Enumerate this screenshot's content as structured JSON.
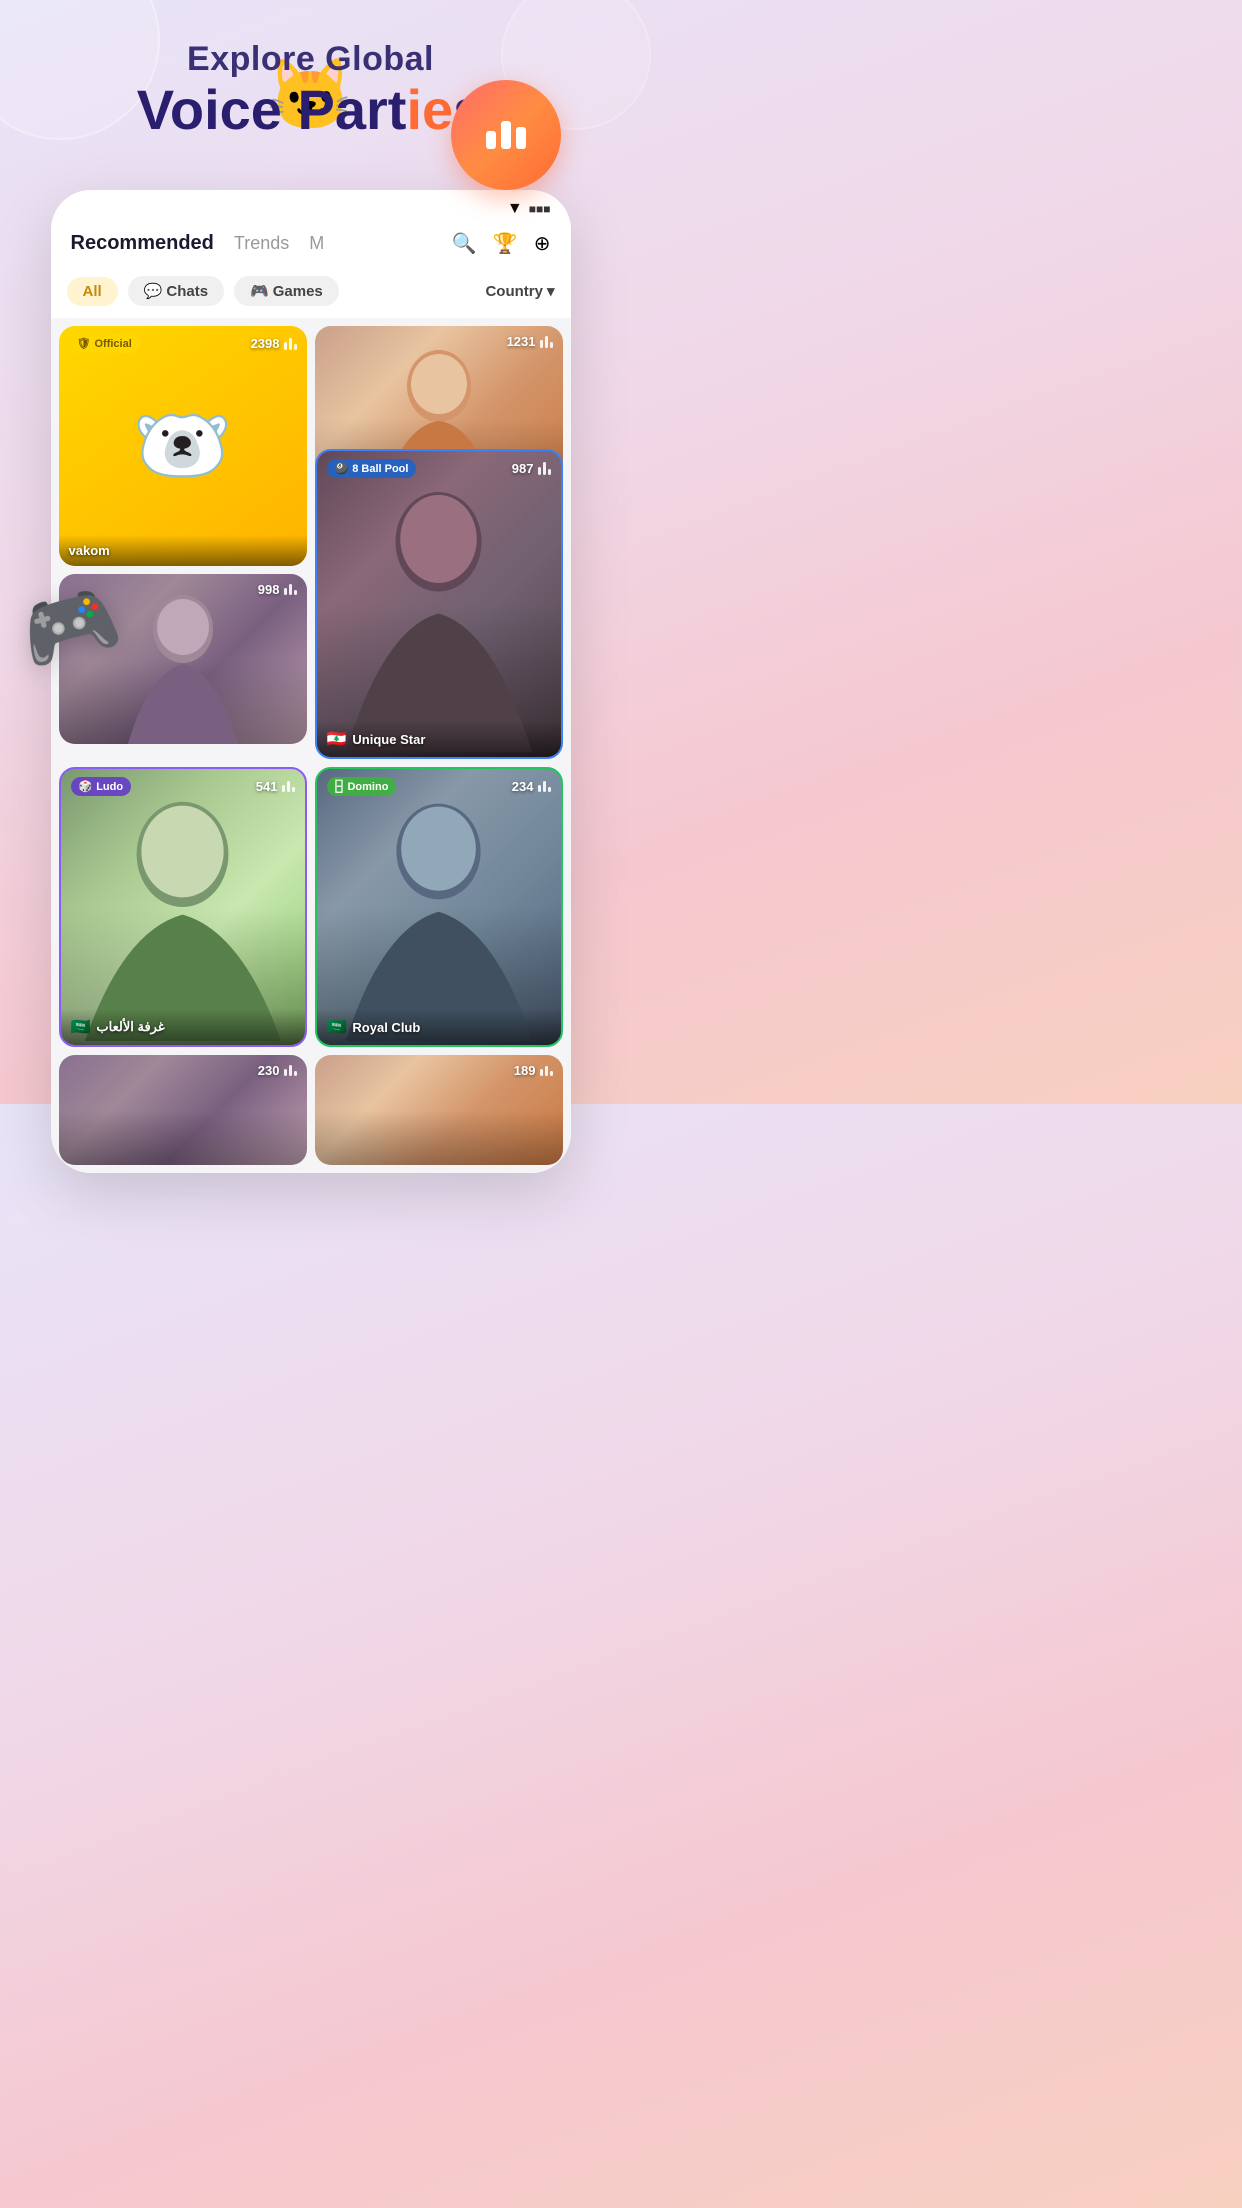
{
  "header": {
    "line1": "Explore Global",
    "line2_prefix": "Voice Part",
    "line2_highlight": "ie",
    "line2_suffix": "s"
  },
  "appIcon": {
    "bars": [
      18,
      28,
      22
    ]
  },
  "nav": {
    "recommended": "Recommended",
    "trends": "Trends",
    "more": "M"
  },
  "filters": {
    "all": "All",
    "chats": "Chats",
    "games": "Games",
    "country": "Country"
  },
  "rooms": [
    {
      "id": "official",
      "badge": "Official",
      "badgeType": "official",
      "count": "2398",
      "name": "vakom",
      "isOfficialBg": true
    },
    {
      "id": "room2",
      "badge": "",
      "badgeType": "",
      "count": "1231",
      "name": "",
      "photoClass": "photo-bg-1"
    },
    {
      "id": "room3",
      "badge": "",
      "badgeType": "",
      "count": "998",
      "name": "",
      "photoClass": "photo-bg-2"
    },
    {
      "id": "8ball",
      "badge": "8 Ball Pool",
      "badgeType": "8ball",
      "count": "987",
      "name": "Unique Star",
      "flag": "🇱🇧",
      "photoClass": "photo-bg-4",
      "borderClass": "card-border-blue"
    },
    {
      "id": "ludo",
      "badge": "Ludo",
      "badgeType": "ludo",
      "count": "541",
      "name": "غرفة الألعاب",
      "flag": "🇸🇦",
      "photoClass": "photo-bg-3",
      "borderClass": "card-border-purple"
    },
    {
      "id": "domino",
      "badge": "Domino",
      "badgeType": "domino",
      "count": "234",
      "name": "Royal Club",
      "flag": "🇸🇦",
      "photoClass": "photo-bg-5",
      "borderClass": "card-border-green"
    },
    {
      "id": "bottom1",
      "count": "230",
      "photoClass": "photo-bg-2"
    },
    {
      "id": "bottom2",
      "count": "189",
      "photoClass": "photo-bg-1"
    }
  ],
  "icons": {
    "search": "🔍",
    "trophy": "🏆",
    "addRoom": "⊕",
    "wifi": "▼",
    "chatsEmoji": "💬",
    "gamesEmoji": "🎮",
    "shield": "🛡",
    "bear": "🐻",
    "ballpool": "🎱",
    "dice": "🎲",
    "domino": "🁣",
    "gameController": "🎮"
  }
}
